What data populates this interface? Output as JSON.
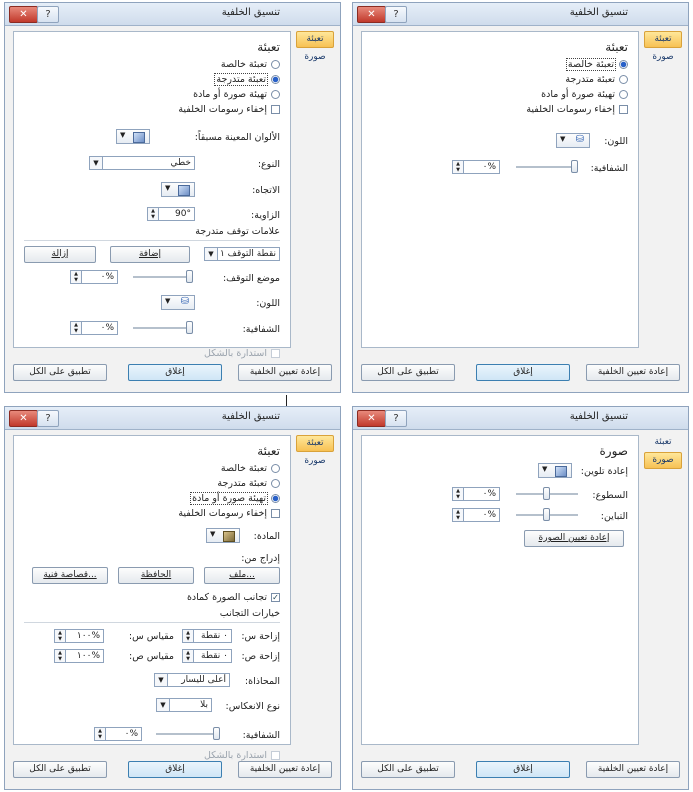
{
  "dialogs": {
    "tr": {
      "title": "تنسيق الخلفية",
      "tabs": [
        "تعبئة",
        "صورة"
      ],
      "heading": "تعبئة",
      "options": [
        "تعبئة خالصة",
        "تعبئة متدرجة",
        "تهيئة صورة أو مادة",
        "إخفاء رسومات الخلفية"
      ],
      "color_label": "اللون:",
      "transparency_label": "الشفافية:",
      "transparency_value": "%٠",
      "buttons": [
        "إعادة تعيين الخلفية",
        "إغلاق",
        "تطبيق على الكل"
      ]
    },
    "tl": {
      "title": "تنسيق الخلفية",
      "tabs": [
        "تعبئة",
        "صورة"
      ],
      "heading": "تعبئة",
      "options": [
        "تعبئة خالصة",
        "تعبئة متدرجة",
        "تهيئة صورة أو مادة",
        "إخفاء رسومات الخلفية"
      ],
      "preset_label": "الألوان المعينة مسبقاً:",
      "type_label": "النوع:",
      "type_value": "خطي",
      "direction_label": "الاتجاه:",
      "angle_label": "الزاوية:",
      "angle_value": "90°",
      "stops_heading": "علامات توقف متدرجة",
      "stop_select": "نقطة التوقف ١",
      "add_label": "إضافة",
      "remove_label": "إزالة",
      "stop_position_label": "موضع التوقف:",
      "stop_position_value": "%٠",
      "color_label": "اللون:",
      "transparency_label": "الشفافية:",
      "transparency_value": "%٠",
      "rotate_label": "استدارة بالشكل",
      "buttons": [
        "إعادة تعيين الخلفية",
        "إغلاق",
        "تطبيق على الكل"
      ]
    },
    "br": {
      "title": "تنسيق الخلفية",
      "tabs": [
        "تعبئة",
        "صورة"
      ],
      "heading": "صورة",
      "recolor_label": "إعادة تلوين:",
      "brightness_label": "السطوع:",
      "brightness_value": "%٠",
      "contrast_label": "التباين:",
      "contrast_value": "%٠",
      "reset_picture": "إعادة تعيين الصورة",
      "buttons": [
        "إعادة تعيين الخلفية",
        "إغلاق",
        "تطبيق على الكل"
      ]
    },
    "bl": {
      "title": "تنسيق الخلفية",
      "tabs": [
        "تعبئة",
        "صورة"
      ],
      "heading": "تعبئة",
      "options": [
        "تعبئة خالصة",
        "تعبئة متدرجة",
        "تهيئة صورة أو مادة",
        "إخفاء رسومات الخلفية"
      ],
      "texture_label": "المادة:",
      "insert_from": "إدراج من:",
      "file_btn": "ملف...",
      "clipboard_btn": "الحافظة",
      "clipart_btn": "قصاصة فنية...",
      "tile_label": "تجانب الصورة كمادة",
      "tiling_heading": "خيارات التجانب",
      "offset_x_label": "إزاحة س:",
      "offset_x_value": "٠ نقطة",
      "scale_x_label": "مقياس س:",
      "scale_x_value": "%١٠٠",
      "offset_y_label": "إزاحة ص:",
      "offset_y_value": "٠ نقطة",
      "scale_y_label": "مقياس ص:",
      "scale_y_value": "%١٠٠",
      "align_label": "المحاذاة:",
      "align_value": "أعلى لليسار",
      "mirror_label": "نوع الانعكاس:",
      "mirror_value": "بلا",
      "transparency_label": "الشفافية:",
      "transparency_value": "%٠",
      "rotate_label": "استدارة بالشكل",
      "buttons": [
        "إعادة تعيين الخلفية",
        "إغلاق",
        "تطبيق على الكل"
      ]
    }
  }
}
